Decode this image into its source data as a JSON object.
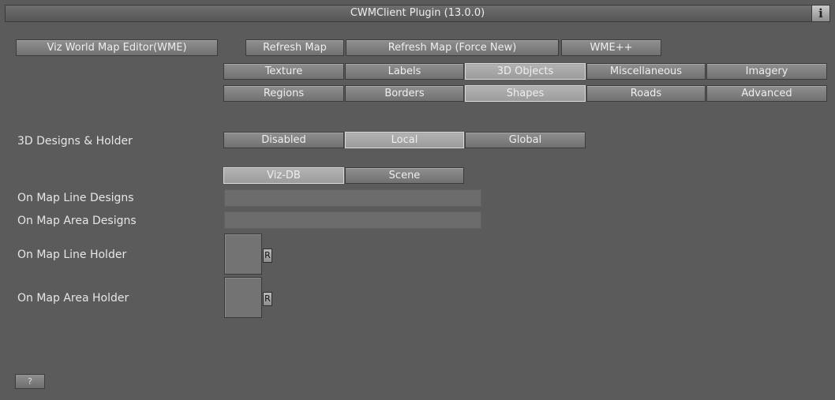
{
  "title": "CWMClient Plugin (13.0.0)",
  "info_label": "i",
  "top_buttons": [
    "Viz World Map Editor(WME)",
    "Refresh Map",
    "Refresh Map (Force New)",
    "WME++"
  ],
  "tabs_row1": [
    "Texture",
    "Labels",
    "3D Objects",
    "Miscellaneous",
    "Imagery"
  ],
  "tabs_row2": [
    "Regions",
    "Borders",
    "Shapes",
    "Roads",
    "Advanced"
  ],
  "designs_holder": {
    "label": "3D Designs & Holder",
    "options": [
      "Disabled",
      "Local",
      "Global"
    ],
    "selected": "Local"
  },
  "source": {
    "options": [
      "Viz-DB",
      "Scene"
    ],
    "selected": "Viz-DB"
  },
  "fields": {
    "line_designs_label": "On Map Line Designs",
    "area_designs_label": "On Map Area Designs",
    "line_designs_value": "",
    "area_designs_value": ""
  },
  "holders": {
    "line_holder_label": "On Map Line Holder",
    "area_holder_label": "On Map Area Holder",
    "reset_label": "R"
  },
  "help_label": "?",
  "colors": {
    "background": "#5b5b5b",
    "button": "#7f7f7f",
    "button_selected": "#a8a8a8",
    "text": "#e6e6e6"
  }
}
